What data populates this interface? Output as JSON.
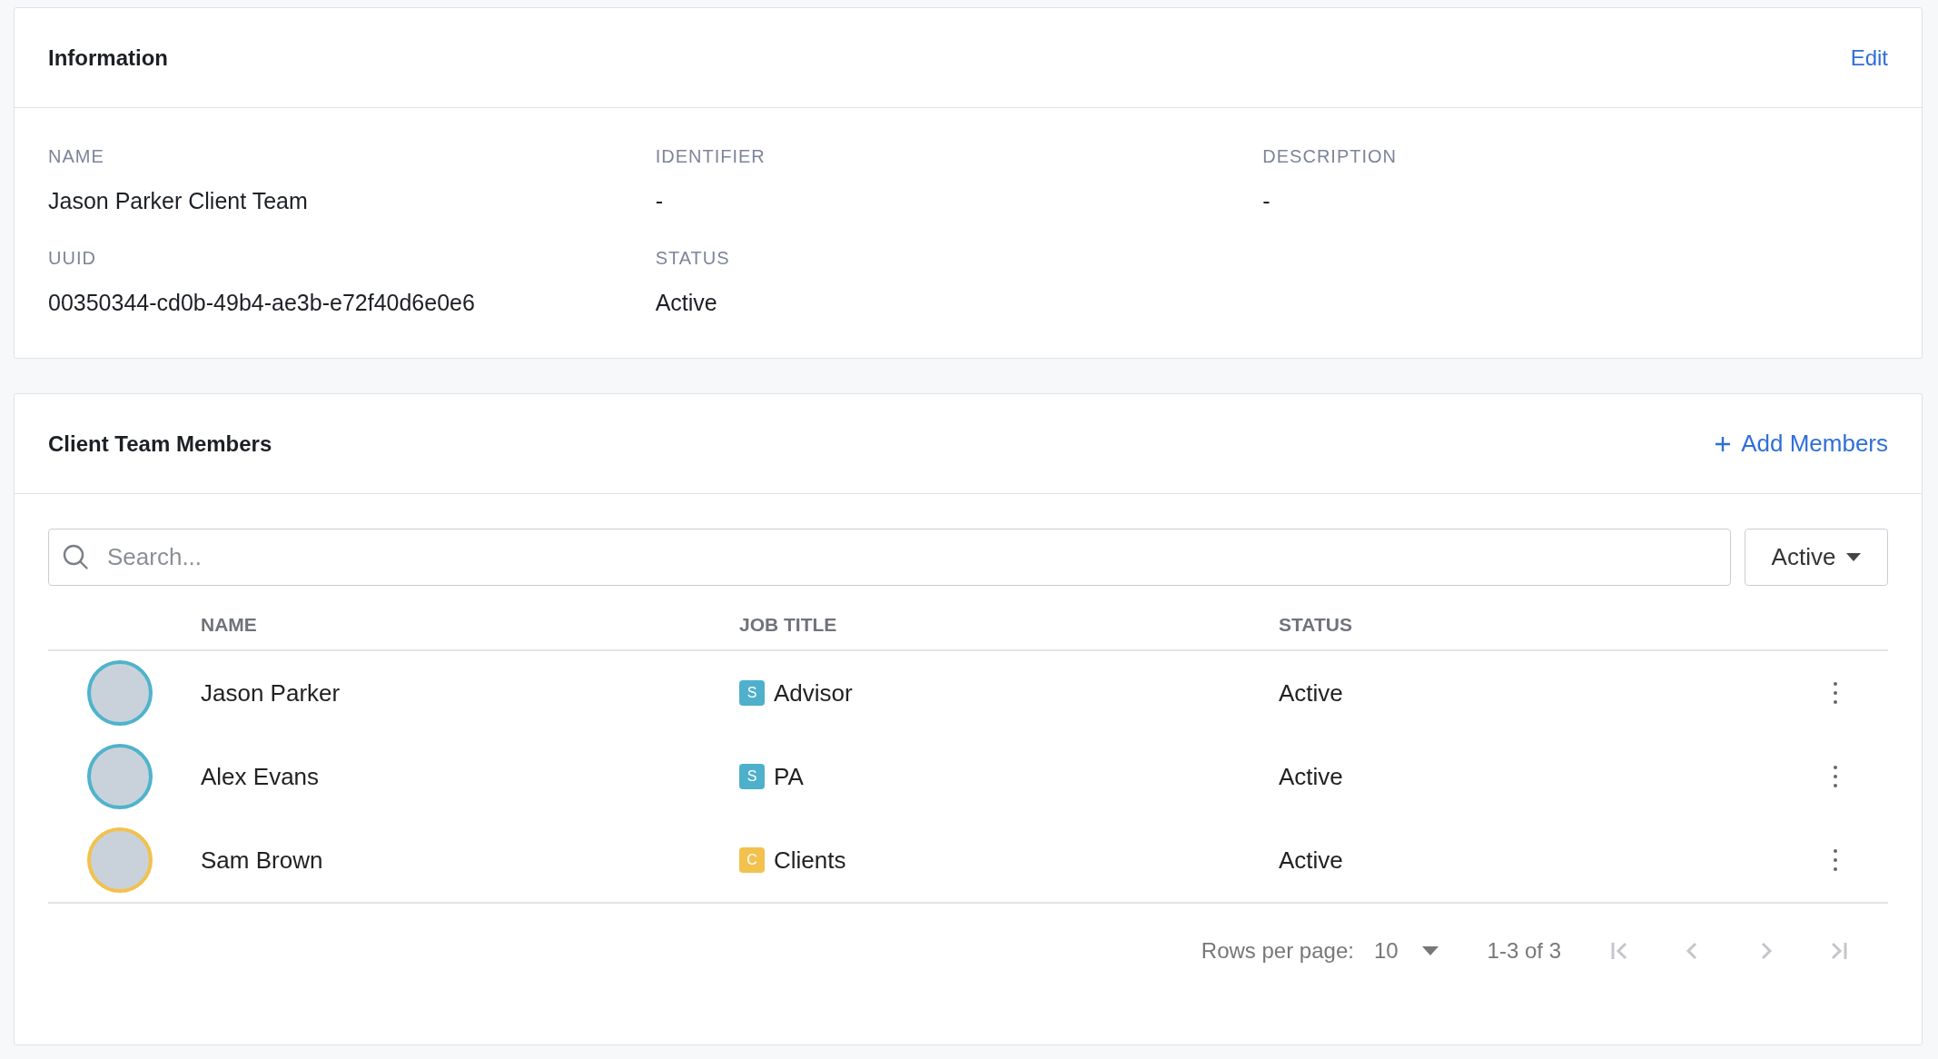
{
  "information": {
    "title": "Information",
    "edit_link": "Edit",
    "fields": [
      {
        "label": "NAME",
        "value": "Jason Parker Client Team"
      },
      {
        "label": "IDENTIFIER",
        "value": "-"
      },
      {
        "label": "DESCRIPTION",
        "value": "-"
      },
      {
        "label": "UUID",
        "value": "00350344-cd0b-49b4-ae3b-e72f40d6e0e6"
      },
      {
        "label": "STATUS",
        "value": "Active"
      }
    ]
  },
  "members": {
    "title": "Client Team Members",
    "add_link": "Add Members",
    "search": {
      "placeholder": "Search..."
    },
    "status_filter": "Active",
    "table": {
      "columns": [
        "NAME",
        "JOB TITLE",
        "STATUS"
      ],
      "rows": [
        {
          "name": "Jason Parker",
          "avatar": {
            "color": "#4fb3cc"
          },
          "badge": {
            "text": "S",
            "color": "#4fb0cc"
          },
          "job_title": "Advisor",
          "status": "Active"
        },
        {
          "name": "Alex Evans",
          "avatar": {
            "color": "#4fb3cc"
          },
          "badge": {
            "text": "S",
            "color": "#4fb0cc"
          },
          "job_title": "PA",
          "status": "Active"
        },
        {
          "name": "Sam Brown",
          "avatar": {
            "color": "#f2c14e"
          },
          "badge": {
            "text": "C",
            "color": "#f2c14e"
          },
          "job_title": "Clients",
          "status": "Active"
        }
      ]
    },
    "pagination": {
      "rows_per_page_label": "Rows per page:",
      "rows_per_page": "10",
      "range": "1-3 of 3",
      "buttons": [
        {
          "kind": "first",
          "disabled": true
        },
        {
          "kind": "prev",
          "disabled": true
        },
        {
          "kind": "next",
          "disabled": true
        },
        {
          "kind": "last",
          "disabled": true
        }
      ]
    }
  }
}
